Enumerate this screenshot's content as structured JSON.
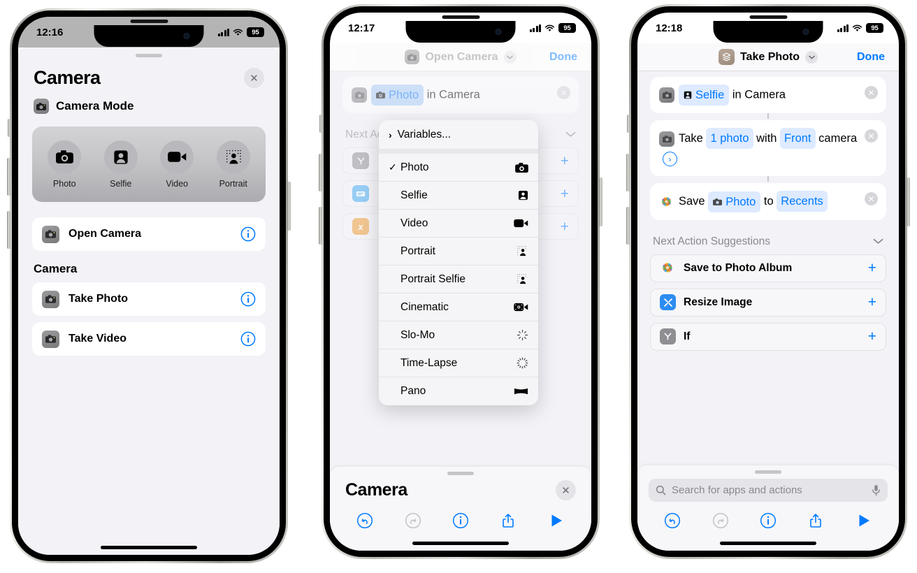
{
  "phone1": {
    "status": {
      "time": "12:16",
      "battery": "95"
    },
    "sheet": {
      "title": "Camera",
      "close_label": "✕",
      "mode_row_label": "Camera Mode",
      "picker": {
        "options": [
          {
            "label": "Photo",
            "icon": "camera-icon"
          },
          {
            "label": "Selfie",
            "icon": "person-portrait-icon"
          },
          {
            "label": "Video",
            "icon": "video-camera-icon"
          },
          {
            "label": "Portrait",
            "icon": "portrait-depth-icon"
          }
        ]
      },
      "top_action": {
        "label": "Open Camera",
        "icon": "camera-app-icon",
        "info": "info-icon"
      },
      "section_header": "Camera",
      "actions": [
        {
          "label": "Take Photo",
          "icon": "camera-app-icon",
          "info": "info-icon"
        },
        {
          "label": "Take Video",
          "icon": "camera-app-icon",
          "info": "info-icon"
        }
      ]
    }
  },
  "phone2": {
    "status": {
      "time": "12:17",
      "battery": "95"
    },
    "navbar": {
      "title": "Open Camera",
      "icon": "camera-app-icon",
      "chevron": "⌄",
      "done_label": "Done"
    },
    "action_card": {
      "leading_icon": "camera-app-icon",
      "chip_label": "Photo",
      "chip_icon": "camera-icon",
      "text_after": "in Camera",
      "remove_label": "✕"
    },
    "suggestions_header": "Next Action Suggestions",
    "suggestions": [
      {
        "icon": "if-icon",
        "plus": "+"
      },
      {
        "icon": "text-icon",
        "plus": "+"
      },
      {
        "icon": "variable-icon",
        "plus": "+"
      }
    ],
    "menu": {
      "variables_label": "Variables...",
      "variables_chevron": "›",
      "items": [
        {
          "label": "Photo",
          "checked": true,
          "icon": "camera-icon"
        },
        {
          "label": "Selfie",
          "checked": false,
          "icon": "person-portrait-icon"
        },
        {
          "label": "Video",
          "checked": false,
          "icon": "video-camera-icon"
        },
        {
          "label": "Portrait",
          "checked": false,
          "icon": "portrait-depth-icon"
        },
        {
          "label": "Portrait Selfie",
          "checked": false,
          "icon": "portrait-depth-icon"
        },
        {
          "label": "Cinematic",
          "checked": false,
          "icon": "cinematic-icon"
        },
        {
          "label": "Slo-Mo",
          "checked": false,
          "icon": "slomo-icon"
        },
        {
          "label": "Time-Lapse",
          "checked": false,
          "icon": "timelapse-icon"
        },
        {
          "label": "Pano",
          "checked": false,
          "icon": "pano-icon"
        }
      ],
      "check_glyph": "✓"
    },
    "dock": {
      "title": "Camera",
      "close_label": "✕",
      "toolbar": [
        {
          "icon": "undo-icon",
          "enabled": true
        },
        {
          "icon": "redo-icon",
          "enabled": false
        },
        {
          "icon": "info-icon",
          "enabled": true
        },
        {
          "icon": "share-icon",
          "enabled": true
        },
        {
          "icon": "play-icon",
          "enabled": true
        }
      ]
    }
  },
  "phone3": {
    "status": {
      "time": "12:18",
      "battery": "95"
    },
    "navbar": {
      "title": "Take Photo",
      "icon": "shortcut-icon",
      "chevron": "⌄",
      "done_label": "Done"
    },
    "cards": [
      {
        "leading_icon": "camera-app-icon",
        "parts": [
          {
            "type": "chip",
            "label": "Selfie",
            "icon": "person-portrait-icon"
          },
          {
            "type": "text",
            "label": "in Camera"
          }
        ],
        "remove_label": "✕"
      },
      {
        "leading_icon": "camera-app-icon",
        "parts": [
          {
            "type": "text",
            "label": "Take"
          },
          {
            "type": "chip_plain",
            "label": "1 photo"
          },
          {
            "type": "text",
            "label": "with"
          },
          {
            "type": "chip_plain",
            "label": "Front"
          },
          {
            "type": "text",
            "label": "camera"
          },
          {
            "type": "chevron",
            "label": "›"
          }
        ],
        "remove_label": "✕"
      },
      {
        "leading_icon": "photos-icon",
        "parts": [
          {
            "type": "text",
            "label": "Save"
          },
          {
            "type": "chip",
            "label": "Photo",
            "icon": "camera-app-icon"
          },
          {
            "type": "text",
            "label": "to"
          },
          {
            "type": "chip_plain",
            "label": "Recents"
          }
        ],
        "remove_label": "✕"
      }
    ],
    "suggestions_header": "Next Action Suggestions",
    "suggestions_chevron": "⌄",
    "suggestions": [
      {
        "label": "Save to Photo Album",
        "icon": "photos-icon",
        "plus": "+"
      },
      {
        "label": "Resize Image",
        "icon": "resize-icon",
        "plus": "+"
      },
      {
        "label": "If",
        "icon": "if-icon",
        "plus": "+"
      }
    ],
    "search": {
      "placeholder": "Search for apps and actions",
      "icon": "search-icon",
      "mic": "mic-icon"
    },
    "toolbar": [
      {
        "icon": "undo-icon",
        "enabled": true
      },
      {
        "icon": "redo-icon",
        "enabled": false
      },
      {
        "icon": "info-icon",
        "enabled": true
      },
      {
        "icon": "share-icon",
        "enabled": true
      },
      {
        "icon": "play-icon",
        "enabled": true
      }
    ]
  },
  "colors": {
    "accent": "#007aff",
    "chip_bg": "#ddeaff",
    "chip_active_bg": "#a9cdf7",
    "sheet_bg": "#f2f2f7"
  }
}
